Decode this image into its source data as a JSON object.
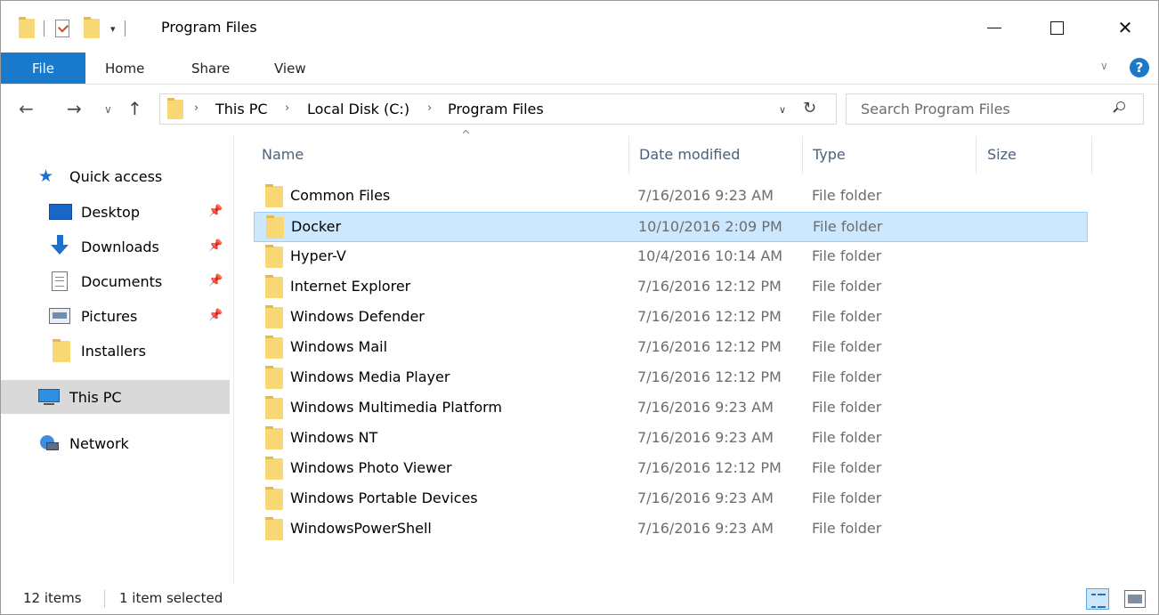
{
  "window": {
    "title": "Program Files",
    "minimize_label": "Minimize",
    "maximize_label": "Maximize",
    "close_label": "Close",
    "close_glyph": "✕"
  },
  "quick_access_toolbar": {
    "dropdown_glyph": "▾"
  },
  "ribbon": {
    "tabs": [
      "File",
      "Home",
      "Share",
      "View"
    ],
    "expand_glyph": "∨",
    "help_glyph": "?",
    "accent_color": "#1979ca"
  },
  "navigation": {
    "back_glyph": "←",
    "forward_glyph": "→",
    "recent_glyph": "∨",
    "up_glyph": "↑",
    "breadcrumb": [
      "This PC",
      "Local Disk (C:)",
      "Program Files"
    ],
    "breadcrumb_sep_glyph": "›",
    "address_dropdown_glyph": "∨",
    "refresh_glyph": "↻"
  },
  "search": {
    "placeholder": "Search Program Files"
  },
  "sidebar": {
    "pin_glyph": "📌",
    "items": [
      {
        "label": "Quick access",
        "icon": "star-icon",
        "glyph": "★"
      },
      {
        "label": "Desktop",
        "icon": "desktop-icon",
        "pinned": true
      },
      {
        "label": "Downloads",
        "icon": "download-icon",
        "pinned": true
      },
      {
        "label": "Documents",
        "icon": "document-icon",
        "pinned": true
      },
      {
        "label": "Pictures",
        "icon": "pictures-icon",
        "pinned": true
      },
      {
        "label": "Installers",
        "icon": "folder-icon"
      },
      {
        "label": "This PC",
        "icon": "this-pc-icon",
        "selected": true
      },
      {
        "label": "Network",
        "icon": "network-icon"
      }
    ]
  },
  "file_list": {
    "columns": [
      "Name",
      "Date modified",
      "Type",
      "Size"
    ],
    "sort_glyph": "^",
    "selected_color": "#cce8ff",
    "rows": [
      {
        "name": "Common Files",
        "date": "7/16/2016 9:23 AM",
        "type": "File folder"
      },
      {
        "name": "Docker",
        "date": "10/10/2016 2:09 PM",
        "type": "File folder",
        "selected": true
      },
      {
        "name": "Hyper-V",
        "date": "10/4/2016 10:14 AM",
        "type": "File folder"
      },
      {
        "name": "Internet Explorer",
        "date": "7/16/2016 12:12 PM",
        "type": "File folder"
      },
      {
        "name": "Windows Defender",
        "date": "7/16/2016 12:12 PM",
        "type": "File folder"
      },
      {
        "name": "Windows Mail",
        "date": "7/16/2016 12:12 PM",
        "type": "File folder"
      },
      {
        "name": "Windows Media Player",
        "date": "7/16/2016 12:12 PM",
        "type": "File folder"
      },
      {
        "name": "Windows Multimedia Platform",
        "date": "7/16/2016 9:23 AM",
        "type": "File folder"
      },
      {
        "name": "Windows NT",
        "date": "7/16/2016 9:23 AM",
        "type": "File folder"
      },
      {
        "name": "Windows Photo Viewer",
        "date": "7/16/2016 12:12 PM",
        "type": "File folder"
      },
      {
        "name": "Windows Portable Devices",
        "date": "7/16/2016 9:23 AM",
        "type": "File folder"
      },
      {
        "name": "WindowsPowerShell",
        "date": "7/16/2016 9:23 AM",
        "type": "File folder"
      }
    ]
  },
  "status": {
    "item_count": "12 items",
    "selection": "1 item selected"
  }
}
